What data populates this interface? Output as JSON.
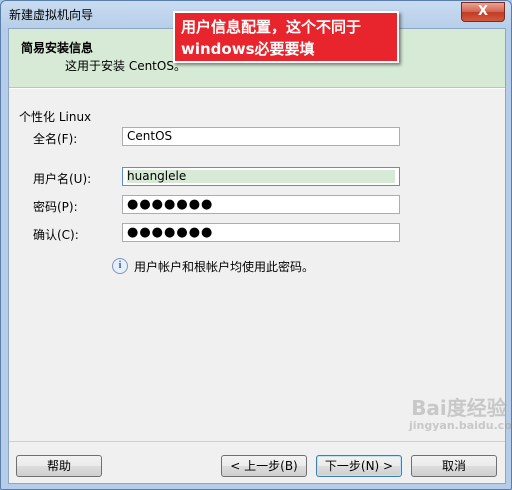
{
  "window": {
    "title": "新建虚拟机向导",
    "close_glyph": "X"
  },
  "header": {
    "title": "简易安装信息",
    "subtitle": "这用于安装 CentOS。"
  },
  "annotation": {
    "text": "用户信息配置，这个不同于windows必要要填"
  },
  "form": {
    "group_label": "个性化 Linux",
    "full_name": {
      "label": "全名(F):",
      "value": "CentOS"
    },
    "username": {
      "label": "用户名(U):",
      "value": "huanglele"
    },
    "password": {
      "label": "密码(P):",
      "value": "●●●●●●●"
    },
    "confirm": {
      "label": "确认(C):",
      "value": "●●●●●●●"
    },
    "info_text": "用户帐户和根帐户均使用此密码。"
  },
  "buttons": {
    "help": "帮助",
    "back": "< 上一步(B)",
    "next": "下一步(N) >",
    "cancel": "取消"
  },
  "watermark": {
    "text": "Bai度经验",
    "sub": "jingyan.baidu.com"
  }
}
